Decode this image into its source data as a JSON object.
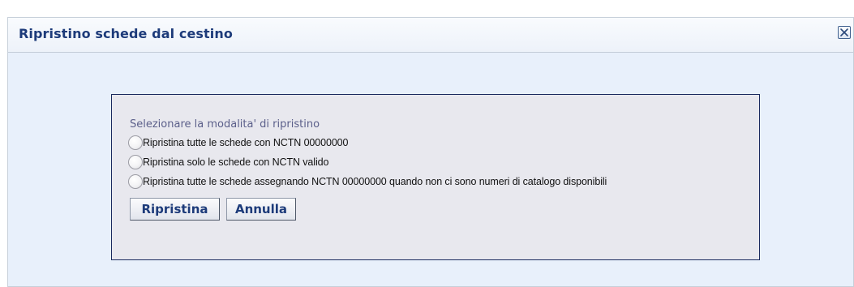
{
  "dialog": {
    "title": "Ripristino schede dal cestino",
    "close_icon": "close-x-icon"
  },
  "panel": {
    "legend": "Selezionare la modalita' di ripristino",
    "options": [
      {
        "label": "Ripristina tutte le schede con NCTN 00000000",
        "selected": false
      },
      {
        "label": "Ripristina solo le schede con NCTN valido",
        "selected": false
      },
      {
        "label": "Ripristina tutte le schede assegnando NCTN 00000000 quando non ci sono numeri di catalogo disponibili",
        "selected": false
      }
    ],
    "buttons": {
      "restore_label": "Ripristina",
      "cancel_label": "Annulla"
    }
  },
  "colors": {
    "title_text": "#1d3b7a",
    "dialog_background": "#e8f0fb",
    "panel_background": "#e8e8ee",
    "panel_border": "#1a2a5e",
    "legend_text": "#5b5f8a"
  }
}
